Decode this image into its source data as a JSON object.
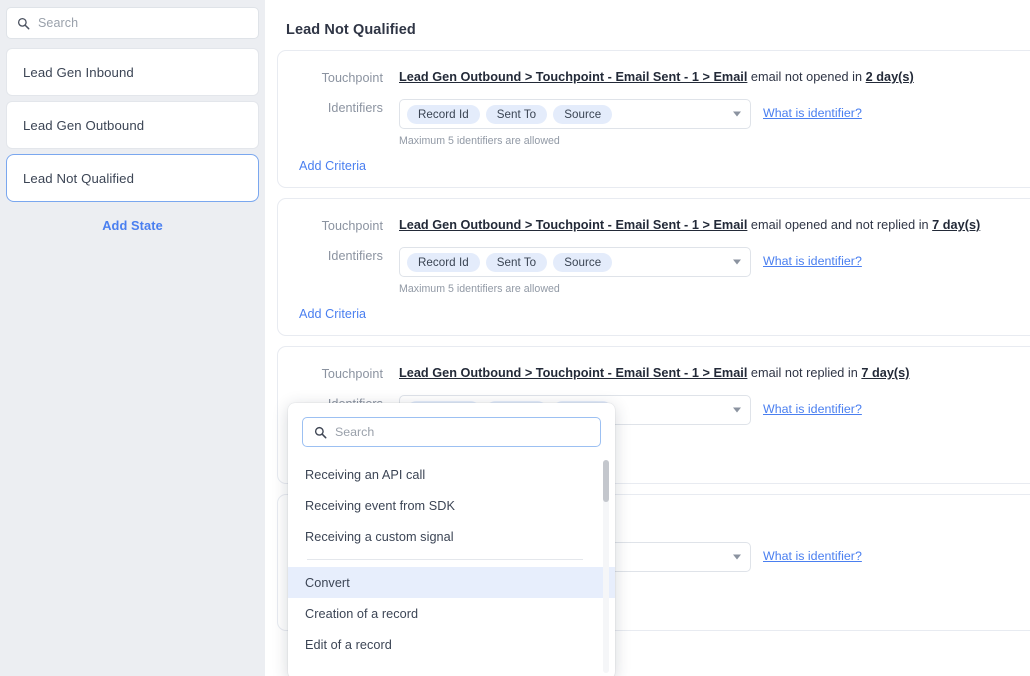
{
  "sidebar": {
    "search": {
      "placeholder": "Search",
      "icon": "search-icon",
      "value": ""
    },
    "states": [
      {
        "label": "Lead Gen Inbound",
        "selected": false
      },
      {
        "label": "Lead Gen Outbound",
        "selected": false
      },
      {
        "label": "Lead Not Qualified",
        "selected": true
      }
    ],
    "add_state_label": "Add State"
  },
  "main": {
    "title": "Lead Not Qualified",
    "labels": {
      "touchpoint": "Touchpoint",
      "identifiers": "Identifiers",
      "hint": "Maximum 5 identifiers are allowed",
      "add_criteria": "Add Criteria",
      "what_is_identifier": "What is identifier?"
    },
    "cards": [
      {
        "touchpoint_path": "Lead Gen Outbound > Touchpoint - Email Sent - 1 > Email",
        "condition_text": " email not opened in ",
        "duration": "2 day(s)",
        "identifiers": [
          "Record Id",
          "Sent To",
          "Source"
        ]
      },
      {
        "touchpoint_path": "Lead Gen Outbound > Touchpoint - Email Sent - 1 > Email",
        "condition_text": " email opened and not replied in ",
        "duration": "7 day(s)",
        "identifiers": [
          "Record Id",
          "Sent To",
          "Source"
        ]
      },
      {
        "touchpoint_path": "Lead Gen Outbound > Touchpoint - Email Sent - 1 > Email",
        "condition_text": " email not replied in ",
        "duration": "7 day(s)",
        "identifiers": [
          "Record Id",
          "Sent To",
          "Source"
        ]
      },
      {
        "touchpoint_path": "",
        "condition_text": "",
        "duration": "",
        "identifiers": []
      }
    ]
  },
  "dropdown": {
    "search": {
      "placeholder": "Search",
      "icon": "search-icon",
      "value": ""
    },
    "items": [
      {
        "label": "Receiving an API call",
        "highlighted": false,
        "separator_after": false
      },
      {
        "label": "Receiving event from SDK",
        "highlighted": false,
        "separator_after": false
      },
      {
        "label": "Receiving a custom signal",
        "highlighted": false,
        "separator_after": true
      },
      {
        "label": "Convert",
        "highlighted": true,
        "separator_after": false
      },
      {
        "label": "Creation of a record",
        "highlighted": false,
        "separator_after": false
      },
      {
        "label": "Edit of a record",
        "highlighted": false,
        "separator_after": false
      }
    ],
    "scroll": {
      "thumb_top_pct": 0,
      "thumb_height_pct": 20
    }
  },
  "colors": {
    "accent": "#4a7ff0",
    "sidebar_bg": "#eceef2",
    "chip_bg": "#e4ecfb",
    "highlight_bg": "#e7eefc",
    "border": "#e8ebf1"
  }
}
